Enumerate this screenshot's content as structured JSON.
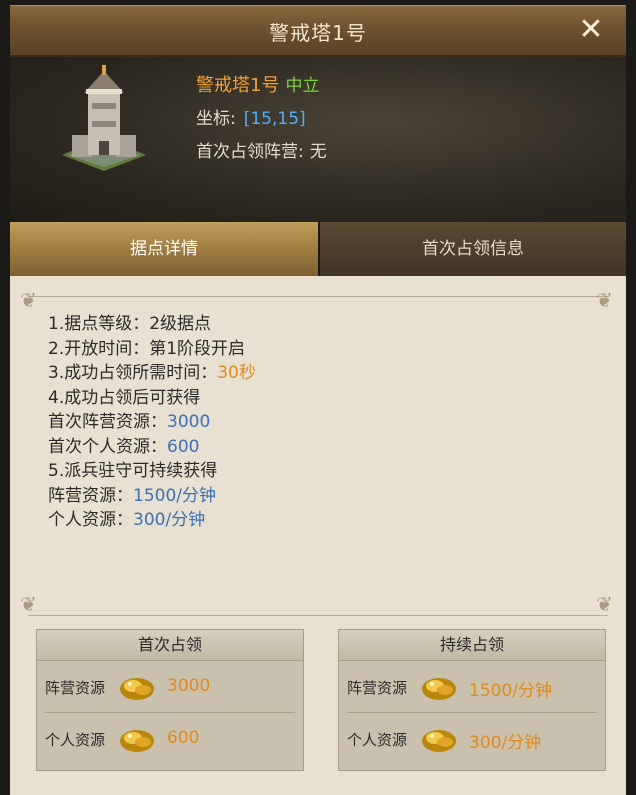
{
  "window": {
    "title": "警戒塔1号",
    "close_label": "✕"
  },
  "header": {
    "name": "警戒塔1号",
    "status": "中立",
    "coord_label": "坐标:",
    "coord_value": "[15,15]",
    "first_camp_label": "首次占领阵营:",
    "first_camp_value": "无"
  },
  "tabs": [
    {
      "label": "据点详情",
      "active": true
    },
    {
      "label": "首次占领信息",
      "active": false
    }
  ],
  "details": {
    "line1": "1.据点等级：2级据点",
    "line2": "2.开放时间：第1阶段开启",
    "line3_label": "3.成功占领所需时间：",
    "line3_value": "30秒",
    "line4": "4.成功占领后可获得",
    "line5_label": "首次阵营资源：",
    "line5_value": "3000",
    "line6_label": "首次个人资源：",
    "line6_value": "600",
    "line7": "5.派兵驻守可持续获得",
    "line8_label": "阵营资源：",
    "line8_value": "1500/分钟",
    "line9_label": "个人资源：",
    "line9_value": "300/分钟"
  },
  "rewards": [
    {
      "title": "首次占领",
      "rows": [
        {
          "label": "阵营资源",
          "icon": "gold-icon",
          "value": "3000"
        },
        {
          "label": "个人资源",
          "icon": "gold-icon",
          "value": "600"
        }
      ]
    },
    {
      "title": "持续占领",
      "rows": [
        {
          "label": "阵营资源",
          "icon": "gold-icon",
          "value": "1500/分钟"
        },
        {
          "label": "个人资源",
          "icon": "gold-icon",
          "value": "300/分钟"
        }
      ]
    }
  ],
  "colors": {
    "accent_orange": "#e08a1e",
    "value_blue": "#3c6fb8",
    "neutral_green": "#79d33f",
    "coord_blue": "#4fb0ff"
  }
}
